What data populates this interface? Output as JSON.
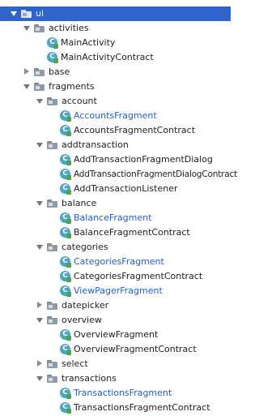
{
  "tree": {
    "root": {
      "label": "ui"
    },
    "activities": {
      "label": "activities"
    },
    "main_activity": {
      "label": "MainActivity"
    },
    "main_activity_contract": {
      "label": "MainActivityContract"
    },
    "base": {
      "label": "base"
    },
    "fragments": {
      "label": "fragments"
    },
    "account": {
      "label": "account"
    },
    "accounts_fragment": {
      "label": "AccountsFragment"
    },
    "accounts_fragment_contract": {
      "label": "AccountsFragmentContract"
    },
    "addtransaction": {
      "label": "addtransaction"
    },
    "add_transaction_fragment_dialog": {
      "label": "AddTransactionFragmentDialog"
    },
    "add_transaction_fragment_dialog_contract": {
      "label": "AddTransactionFragmentDialogContract"
    },
    "add_transaction_listener": {
      "label": "AddTransactionListener"
    },
    "balance": {
      "label": "balance"
    },
    "balance_fragment": {
      "label": "BalanceFragment"
    },
    "balance_fragment_contract": {
      "label": "BalanceFragmentContract"
    },
    "categories": {
      "label": "categories"
    },
    "categories_fragment": {
      "label": "CategoriesFragment"
    },
    "categories_fragment_contract": {
      "label": "CategoriesFragmentContract"
    },
    "view_pager_fragment": {
      "label": "ViewPagerFragment"
    },
    "datepicker": {
      "label": "datepicker"
    },
    "overview": {
      "label": "overview"
    },
    "overview_fragment": {
      "label": "OverviewFragment"
    },
    "overview_fragment_contract": {
      "label": "OverviewFragmentContract"
    },
    "select": {
      "label": "select"
    },
    "transactions": {
      "label": "transactions"
    },
    "transactions_fragment": {
      "label": "TransactionsFragment"
    },
    "transactions_fragment_contract": {
      "label": "TransactionsFragmentContract"
    }
  },
  "icons": {
    "package": "folder-icon",
    "class": "kotlin-class-icon",
    "expanded": "chevron-down-icon",
    "collapsed": "chevron-right-icon"
  },
  "colors": {
    "selection": "#2f65ca",
    "modified_file": "#2a5fb8",
    "class_icon": "#49a6c9",
    "kotlin_badge": "#4fa052"
  }
}
